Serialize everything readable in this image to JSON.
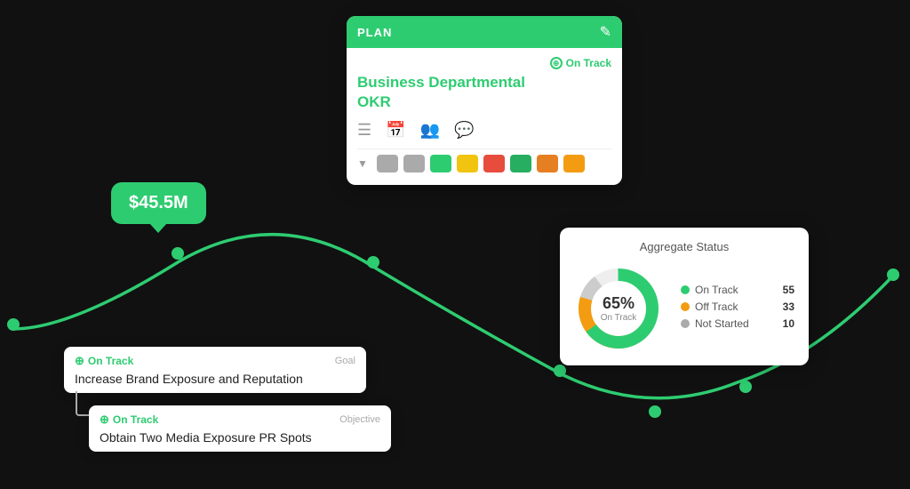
{
  "plan_card": {
    "header_label": "PLAN",
    "status_label": "On Track",
    "title_line1": "Business Departmental",
    "title_line2": "OKR",
    "colors": [
      "#aaa",
      "#aaa",
      "#2ecc71",
      "#f1c40f",
      "#e74c3c",
      "#27ae60",
      "#e67e22",
      "#f39c12"
    ]
  },
  "money_bubble": {
    "value": "$45.5M"
  },
  "aggregate": {
    "title": "Aggregate Status",
    "percent": "65%",
    "percent_label": "On Track",
    "legend": [
      {
        "label": "On Track",
        "count": "55",
        "color": "#2ecc71"
      },
      {
        "label": "Off Track",
        "count": "33",
        "color": "#f39c12"
      },
      {
        "label": "Not Started",
        "count": "10",
        "color": "#aaa"
      }
    ]
  },
  "goal_card": {
    "status": "On Track",
    "type": "Goal",
    "text": "Increase Brand Exposure and Reputation"
  },
  "objective_card": {
    "status": "On Track",
    "type": "Objective",
    "text": "Obtain Two Media Exposure PR Spots"
  }
}
